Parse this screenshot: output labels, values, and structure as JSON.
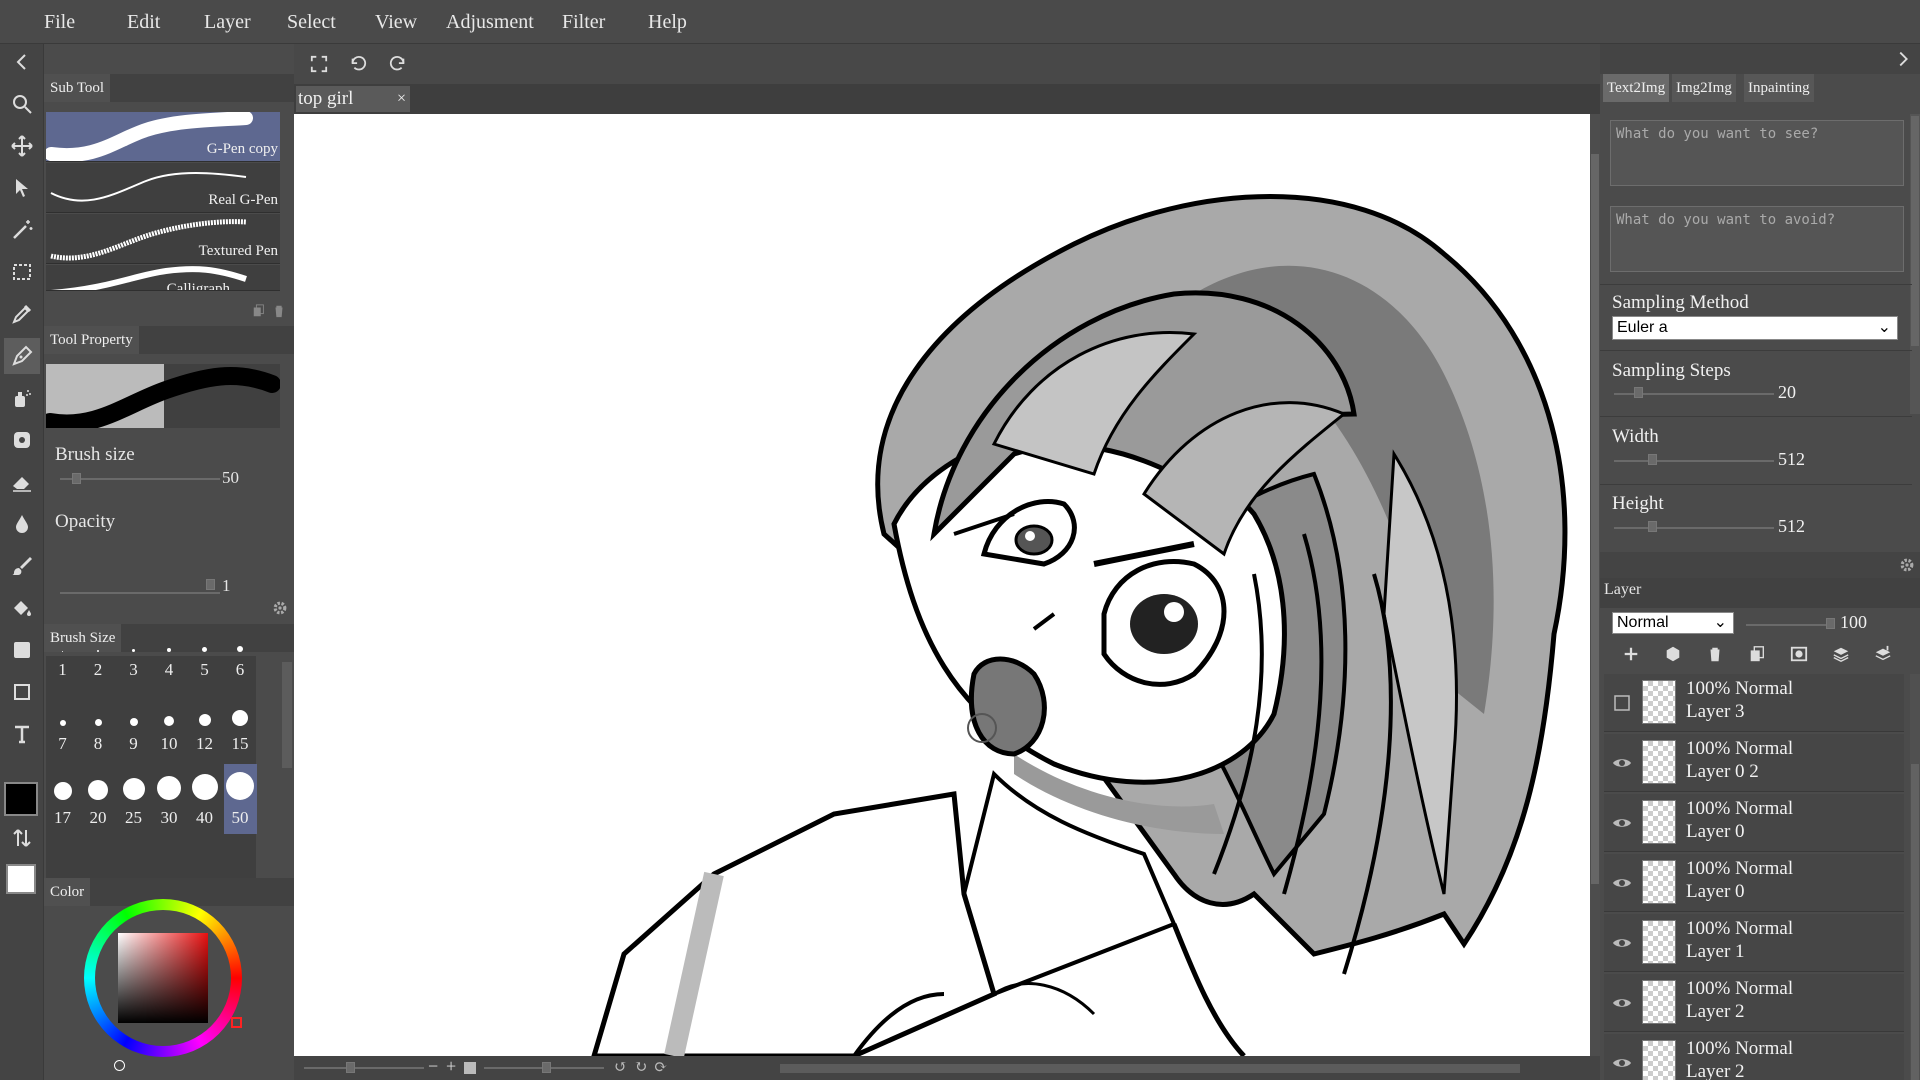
{
  "menu": [
    "File",
    "Edit",
    "Layer",
    "Select",
    "View",
    "Adjusment",
    "Filter",
    "Help"
  ],
  "left_panel": {
    "subtool_title": "Sub Tool",
    "brushes": [
      {
        "name": "G-Pen copy",
        "selected": true
      },
      {
        "name": "Real G-Pen",
        "selected": false
      },
      {
        "name": "Textured Pen",
        "selected": false
      },
      {
        "name": "Calligraph",
        "selected": false
      }
    ],
    "tool_property_title": "Tool Property",
    "brush_size_label": "Brush size",
    "brush_size_value": "50",
    "opacity_label": "Opacity",
    "opacity_value": "1",
    "brush_size_panel_title": "Brush Size",
    "sizes": [
      "1",
      "2",
      "3",
      "4",
      "5",
      "6",
      "7",
      "8",
      "9",
      "10",
      "12",
      "15",
      "17",
      "20",
      "25",
      "30",
      "40",
      "50"
    ],
    "selected_size": "50",
    "color_title": "Color",
    "primary_color": "#000000",
    "secondary_color": "#ffffff"
  },
  "document": {
    "tab_label": "top girl",
    "close": "×"
  },
  "right_panel": {
    "tabs": [
      "Text2Img",
      "Img2Img",
      "Inpainting"
    ],
    "prompt_placeholder": "What do you want to see?",
    "negative_placeholder": "What do you want to avoid?",
    "sampling_method_label": "Sampling Method",
    "sampling_method_value": "Euler a",
    "sampling_steps_label": "Sampling Steps",
    "sampling_steps_value": "20",
    "width_label": "Width",
    "width_value": "512",
    "height_label": "Height",
    "height_value": "512",
    "layer_title": "Layer",
    "blend_mode": "Normal",
    "layer_opacity": "100",
    "layers": [
      {
        "line1": "100% Normal",
        "line2": "Layer 3",
        "visible": false
      },
      {
        "line1": "100% Normal",
        "line2": "Layer 0 2",
        "visible": true
      },
      {
        "line1": "100% Normal",
        "line2": "Layer 0",
        "visible": true
      },
      {
        "line1": "100% Normal",
        "line2": "Layer 0",
        "visible": true
      },
      {
        "line1": "100% Normal",
        "line2": "Layer 1",
        "visible": true
      },
      {
        "line1": "100% Normal",
        "line2": "Layer 2",
        "visible": true
      },
      {
        "line1": "100% Normal",
        "line2": "Layer 2",
        "visible": true
      }
    ]
  },
  "tools": [
    "search-icon",
    "move-icon",
    "select-arrow-icon",
    "magic-wand-icon",
    "marquee-icon",
    "eyedropper-icon",
    "pen-icon",
    "airbrush-icon",
    "decoration-icon",
    "eraser-icon",
    "blur-drop-icon",
    "brush-icon",
    "fill-bucket-icon",
    "gradient-icon",
    "shape-icon",
    "text-icon"
  ]
}
